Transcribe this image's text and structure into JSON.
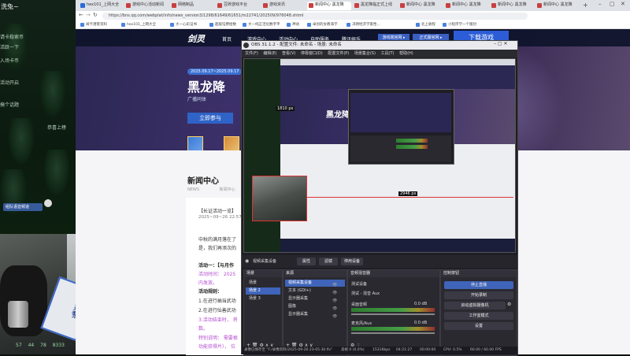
{
  "stream_panel": {
    "header": "洗兔~",
    "rows": [
      "请卡稳索币",
      "活跃一下",
      "入场卡币",
      "活动开启",
      "搞个话题",
      "恭喜上榜"
    ],
    "voice_badge": "组队语音频道",
    "bottom_counts": [
      "57",
      "44",
      "78",
      "8333"
    ]
  },
  "browser": {
    "tabs": [
      "hex101_上网大全",
      "游戏中心活动新闻",
      "网络制品",
      "豆砖游戏平台",
      "游戏资讯",
      "新闻中心 黑龙降",
      "黑龙降临正式上线",
      "新闻中心 黑龙降",
      "新闻中心 黑龙降",
      "新闻中心 黑龙降",
      "新闻中心 黑龙降"
    ],
    "url": "https://bns.qq.com/webplat/info/news_version3/1298/61649/61651/m22741/202509/976048.shtml",
    "bookmarks": [
      "阔卡潜客资料",
      "hex101_上网大全",
      "大一心彩证书",
      "超级馆费给数",
      "大一纯正活化数字平",
      "神动",
      "卓创的女教海学",
      "决明经济学家性…",
      "北上收程",
      "小程序学一个版封"
    ]
  },
  "site": {
    "logo": "剑灵",
    "nav": [
      "首页",
      "游戏中心",
      "活动中心",
      "自助服务",
      "腾讯娱乐"
    ],
    "nav_btn1": "游戏端官网 ▸",
    "nav_btn2": "正式服官网 ▸",
    "download": "下载游戏",
    "date_range": "2025.09.17~2025.09.17",
    "big_title": "黑龙降",
    "subtitle": "广播同体",
    "cta": "立即参与",
    "section_title": "新闻中心",
    "crumb1": "NEWS",
    "crumb2": "新闻中心",
    "article_title": "【长证活动一览】",
    "article_date": "2025~09~26 22:57",
    "para1": "中秋的满月落在了",
    "para2": "是，我们再添次的",
    "ev1": "活动一：【与月作",
    "ev_time": "活动时间： 2025",
    "ev_dist": "内发放。",
    "rules": "活动规则：",
    "r1": "1.在进行岫当武功",
    "r2": "2.在进行仙善武功",
    "r3": "3.活动结束时， 将",
    "r4": "数。",
    "note": "特别说明： 需要根",
    "note2": "功能获得片）， 位"
  },
  "obs": {
    "title": "OBS 31.1.2 - 配置文件: 未命名 - 场景: 未命名",
    "menu": [
      "文件(F)",
      "编辑(E)",
      "查看(V)",
      "停靠窗口(D)",
      "配置文件(P)",
      "场景集合(S)",
      "工具(T)",
      "帮助(H)"
    ],
    "source_label": "视频采集设备",
    "props_btn": "属性",
    "filter_btn": "滤镜",
    "deactivate_btn": "停用设备",
    "preview_dims": [
      "1810 px",
      "2946 px"
    ],
    "scenes_title": "场景",
    "scenes": [
      "场景",
      "场景 2",
      "场景 3"
    ],
    "sources_title": "来源",
    "sources": [
      "视频采集设备",
      "文本 (GDI+)",
      "显示器采集",
      "图像",
      "显示器采集"
    ],
    "mixer_title": "音频混音器",
    "mixer_tracks": [
      {
        "name": "桌面音频",
        "db": "0.0 dB"
      },
      {
        "name": "麦克风/Aux",
        "db": "0.0 dB"
      }
    ],
    "mixer_inputs": [
      "测试设备",
      "测试 - 混音 Aux"
    ],
    "controls_title": "控制按钮",
    "controls": [
      "停止直播",
      "开始录制",
      "启动虚拟摄像机",
      "工作室模式",
      "设置"
    ],
    "status_left": "录像已保存至 \"F:/录像资料/2025-09-26 23-05-30.flv\"",
    "status_items": [
      "丢帧 0 (0.0%)",
      "1531Kbps",
      "04:21:27",
      "00:00:00",
      "CPU: 0.5%",
      "60.00 / 60.00 FPS"
    ]
  },
  "webcam": {
    "card_text": "红熊猫",
    "card_sub": "欢迎光临"
  }
}
